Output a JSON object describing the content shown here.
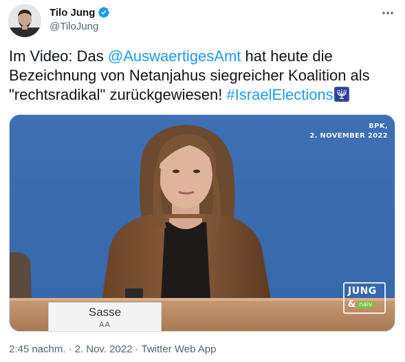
{
  "author": {
    "name": "Tilo Jung",
    "handle": "@TiloJung",
    "verified": true
  },
  "tweet": {
    "text_before": "Im Video: Das ",
    "mention": "@AuswaertigesAmt",
    "text_middle": " hat heute die Bezeichnung von Netanjahus siegreicher Koalition als \"rechtsradikal\" zurückgewiesen! ",
    "hashtag": "#IsraelElections"
  },
  "media": {
    "overlay_line1": "BPK,",
    "overlay_line2": "2. NOVEMBER 2022",
    "nameplate_name": "Sasse",
    "nameplate_org": "AA",
    "logo_top": "JUNG",
    "logo_amp": "&",
    "logo_naiv": "naiv"
  },
  "meta": {
    "time": "2:45 nachm.",
    "separator": "·",
    "date": "2. Nov. 2022",
    "app": "Twitter Web App"
  },
  "colors": {
    "link": "#1d9bf0",
    "muted": "#536471",
    "background_blue": "#3c6fb1"
  },
  "icons": {
    "verified": "verified-badge-icon",
    "more": "more-options-icon",
    "emoji": "menorah-emoji-icon"
  }
}
